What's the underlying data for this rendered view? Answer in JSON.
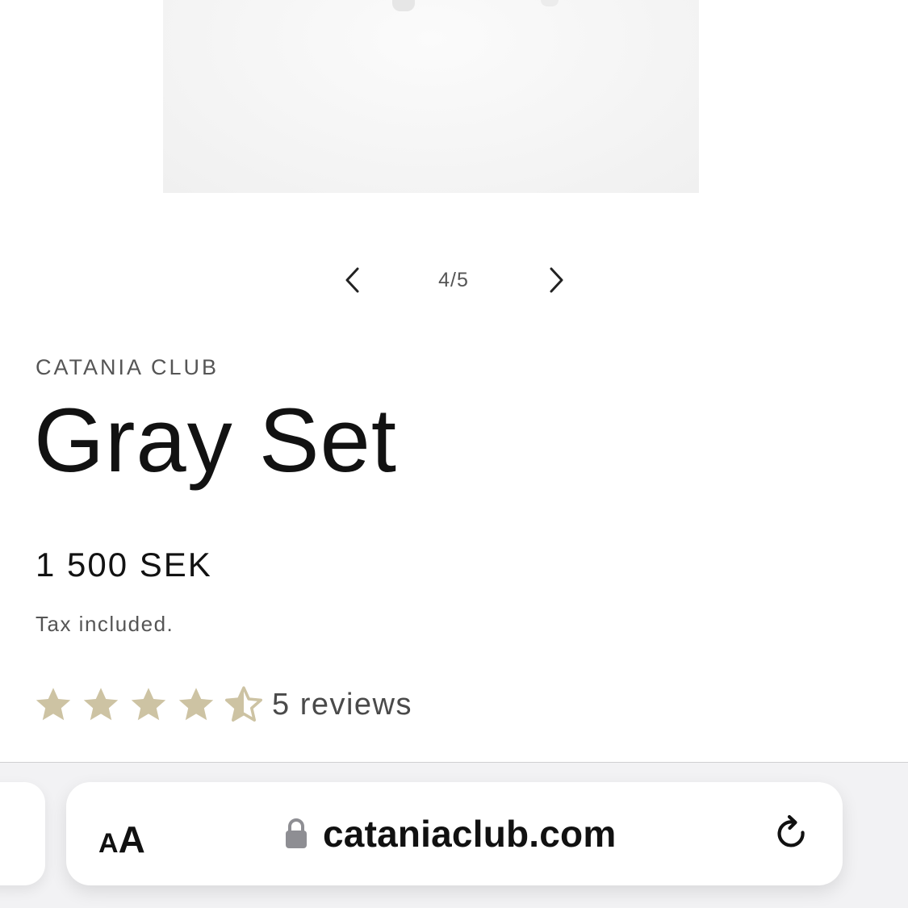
{
  "product": {
    "vendor": "CATANIA CLUB",
    "title": "Gray Set",
    "price": "1 500 SEK",
    "tax_note": "Tax included.",
    "rating": {
      "value": 4.5,
      "max": 5,
      "reviews_label": "5 reviews"
    }
  },
  "slider": {
    "counter": "4/5",
    "prev_icon": "chevron-left-icon",
    "next_icon": "chevron-right-icon"
  },
  "browser": {
    "text_size_small": "A",
    "text_size_large": "A",
    "url": "cataniaclub.com",
    "lock_icon": "lock-icon",
    "reload_icon": "reload-icon"
  },
  "colors": {
    "star": "#cdc3a3",
    "text_primary": "#121212",
    "text_secondary": "#555555",
    "browser_bar_bg": "#f2f2f4"
  }
}
